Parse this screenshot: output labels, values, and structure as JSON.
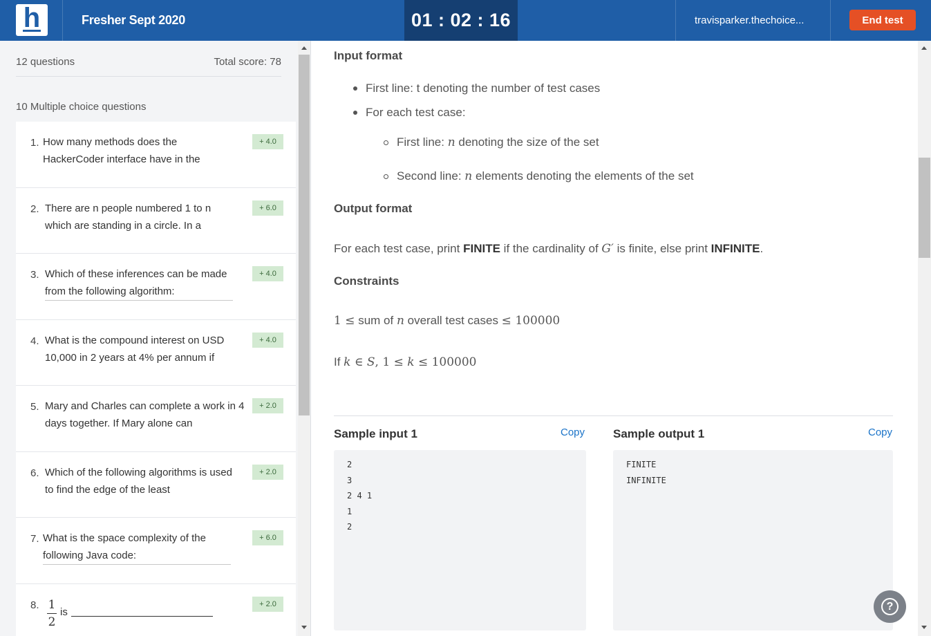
{
  "header": {
    "logo_letter": "h",
    "test_title": "Fresher Sept 2020",
    "timer": "01 : 02 : 16",
    "username": "travisparker.thechoice...",
    "end_button": "End test"
  },
  "sidebar": {
    "question_count": "12 questions",
    "total_score": "Total score: 78",
    "section_label": "10 Multiple choice questions",
    "questions": [
      {
        "num": "1.",
        "text": "How many methods does the HackerCoder interface have in the",
        "score": "+ 4.0"
      },
      {
        "num": "2.",
        "text": "There are n people numbered 1 to n which are standing in a circle. In a",
        "score": "+ 6.0"
      },
      {
        "num": "3.",
        "text": "Which of these inferences can be made from the following algorithm:",
        "score": "+ 4.0"
      },
      {
        "num": "4.",
        "text": "What is the compound interest on USD 10,000 in 2 years at 4% per annum if",
        "score": "+ 4.0"
      },
      {
        "num": "5.",
        "text": "Mary and Charles can complete a work in 4 days together. If Mary alone can",
        "score": "+ 2.0"
      },
      {
        "num": "6.",
        "text": "Which of the following algorithms is used to find the edge of the least",
        "score": "+ 2.0"
      },
      {
        "num": "7.",
        "text": "What is the space complexity of the following Java code:",
        "score": "+ 6.0"
      },
      {
        "num": "8.",
        "frac_num": "1",
        "frac_den": "2",
        "text": "is",
        "score": "+ 2.0"
      }
    ]
  },
  "problem": {
    "input_format_heading": "Input format",
    "bullet_1": "First line: t denoting the number of test cases",
    "bullet_2": "For each test case:",
    "sub_1_pre": "First line: ",
    "sub_1_var": "n",
    "sub_1_post": " denoting the size of the set",
    "sub_2_pre": "Second line: ",
    "sub_2_var": "n",
    "sub_2_post": " elements denoting the elements of the set",
    "output_format_heading": "Output format",
    "output_pre": "For each test case, print ",
    "output_finite": "FINITE",
    "output_mid": " if the cardinality of ",
    "output_var": "G′",
    "output_mid2": " is finite, else print ",
    "output_infinite": "INFINITE",
    "output_end": ".",
    "constraints_heading": "Constraints",
    "constraint_1_a": "1 ≤",
    "constraint_1_b": " sum of ",
    "constraint_1_var": "n",
    "constraint_1_c": " overall test cases ",
    "constraint_1_d": "≤ 100000",
    "constraint_2_if": "If ",
    "constraint_2_a": "k",
    "constraint_2_b": " ∈ ",
    "constraint_2_c": "S",
    "constraint_2_d": ", 1 ≤ ",
    "constraint_2_e": "k",
    "constraint_2_f": " ≤ 100000"
  },
  "samples": {
    "input_title": "Sample input 1",
    "output_title": "Sample output 1",
    "copy_label": "Copy",
    "input_lines": [
      "2",
      "3",
      "2 4 1",
      "1",
      "2"
    ],
    "output_lines": [
      "FINITE",
      "INFINITE"
    ]
  },
  "help": {
    "glyph": "?"
  }
}
